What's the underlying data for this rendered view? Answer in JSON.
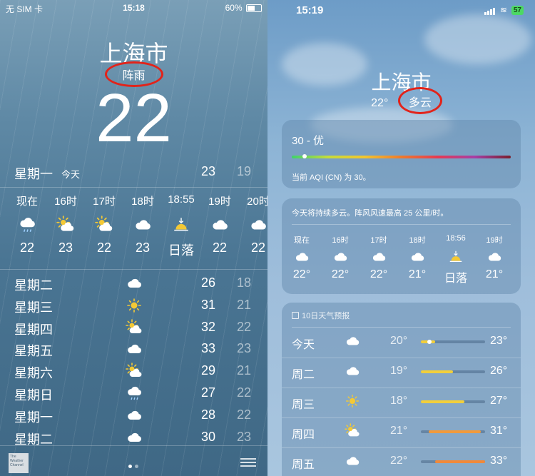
{
  "left": {
    "status": {
      "carrier": "无 SIM 卡",
      "time": "15:18",
      "battery": "60%"
    },
    "city": "上海市",
    "condition": "阵雨",
    "temp": "22",
    "today": {
      "day": "星期一",
      "label": "今天",
      "high": "23",
      "low": "19"
    },
    "hourly": [
      {
        "label": "现在",
        "icon": "rain-cloud-icon",
        "value": "22"
      },
      {
        "label": "16时",
        "icon": "partly-sunny-icon",
        "value": "23"
      },
      {
        "label": "17时",
        "icon": "partly-sunny-icon",
        "value": "22"
      },
      {
        "label": "18时",
        "icon": "cloud-icon",
        "value": "23"
      },
      {
        "label": "18:55",
        "icon": "sunset-icon",
        "value": "日落"
      },
      {
        "label": "19时",
        "icon": "cloud-icon",
        "value": "22"
      },
      {
        "label": "20时",
        "icon": "cloud-icon",
        "value": "22"
      }
    ],
    "daily": [
      {
        "day": "星期二",
        "icon": "cloud-icon",
        "high": "26",
        "low": "18"
      },
      {
        "day": "星期三",
        "icon": "sun-icon",
        "high": "31",
        "low": "21"
      },
      {
        "day": "星期四",
        "icon": "partly-sunny-icon",
        "high": "32",
        "low": "22"
      },
      {
        "day": "星期五",
        "icon": "cloud-icon",
        "high": "33",
        "low": "23"
      },
      {
        "day": "星期六",
        "icon": "partly-sunny-icon",
        "high": "29",
        "low": "21"
      },
      {
        "day": "星期日",
        "icon": "rain-cloud-icon",
        "high": "27",
        "low": "22"
      },
      {
        "day": "星期一",
        "icon": "cloud-icon",
        "high": "28",
        "low": "22"
      },
      {
        "day": "星期二",
        "icon": "cloud-icon",
        "high": "30",
        "low": "23"
      }
    ],
    "logo_text": "The Weather Channel"
  },
  "right": {
    "status": {
      "time": "15:19",
      "battery": "57"
    },
    "city": "上海市",
    "temp": "22°",
    "condition": "多云",
    "aqi": {
      "value": "30 - 优",
      "desc": "当前 AQI (CN) 为 30。",
      "level": 0.06
    },
    "hourly_summary": "今天将持续多云。阵风风速最高 25 公里/时。",
    "hourly": [
      {
        "label": "现在",
        "icon": "cloud-icon",
        "value": "22°"
      },
      {
        "label": "16时",
        "icon": "cloud-icon",
        "value": "22°"
      },
      {
        "label": "17时",
        "icon": "cloud-icon",
        "value": "22°"
      },
      {
        "label": "18时",
        "icon": "cloud-icon",
        "value": "21°"
      },
      {
        "label": "18:56",
        "icon": "sunset-icon",
        "value": "日落"
      },
      {
        "label": "19时",
        "icon": "cloud-icon",
        "value": "21°"
      }
    ],
    "ten_day_title": "10日天气预报",
    "ten_day": [
      {
        "day": "今天",
        "icon": "cloud-icon",
        "low": "20°",
        "high": "23°",
        "range_start": 0.0,
        "range_end": 0.22,
        "current": 0.13,
        "color": "#f2cf3b"
      },
      {
        "day": "周二",
        "icon": "cloud-icon",
        "low": "19°",
        "high": "26°",
        "range_start": 0.0,
        "range_end": 0.5,
        "color": "#f2cf3b"
      },
      {
        "day": "周三",
        "icon": "sun-icon",
        "low": "18°",
        "high": "27°",
        "range_start": 0.0,
        "range_end": 0.68,
        "color": "#f2cf3b"
      },
      {
        "day": "周四",
        "icon": "partly-sunny-icon",
        "low": "21°",
        "high": "31°",
        "range_start": 0.12,
        "range_end": 0.93,
        "color": "#f19a3c"
      },
      {
        "day": "周五",
        "icon": "cloud-icon",
        "low": "22°",
        "high": "33°",
        "range_start": 0.22,
        "range_end": 1.0,
        "color": "#f0893a"
      }
    ]
  }
}
